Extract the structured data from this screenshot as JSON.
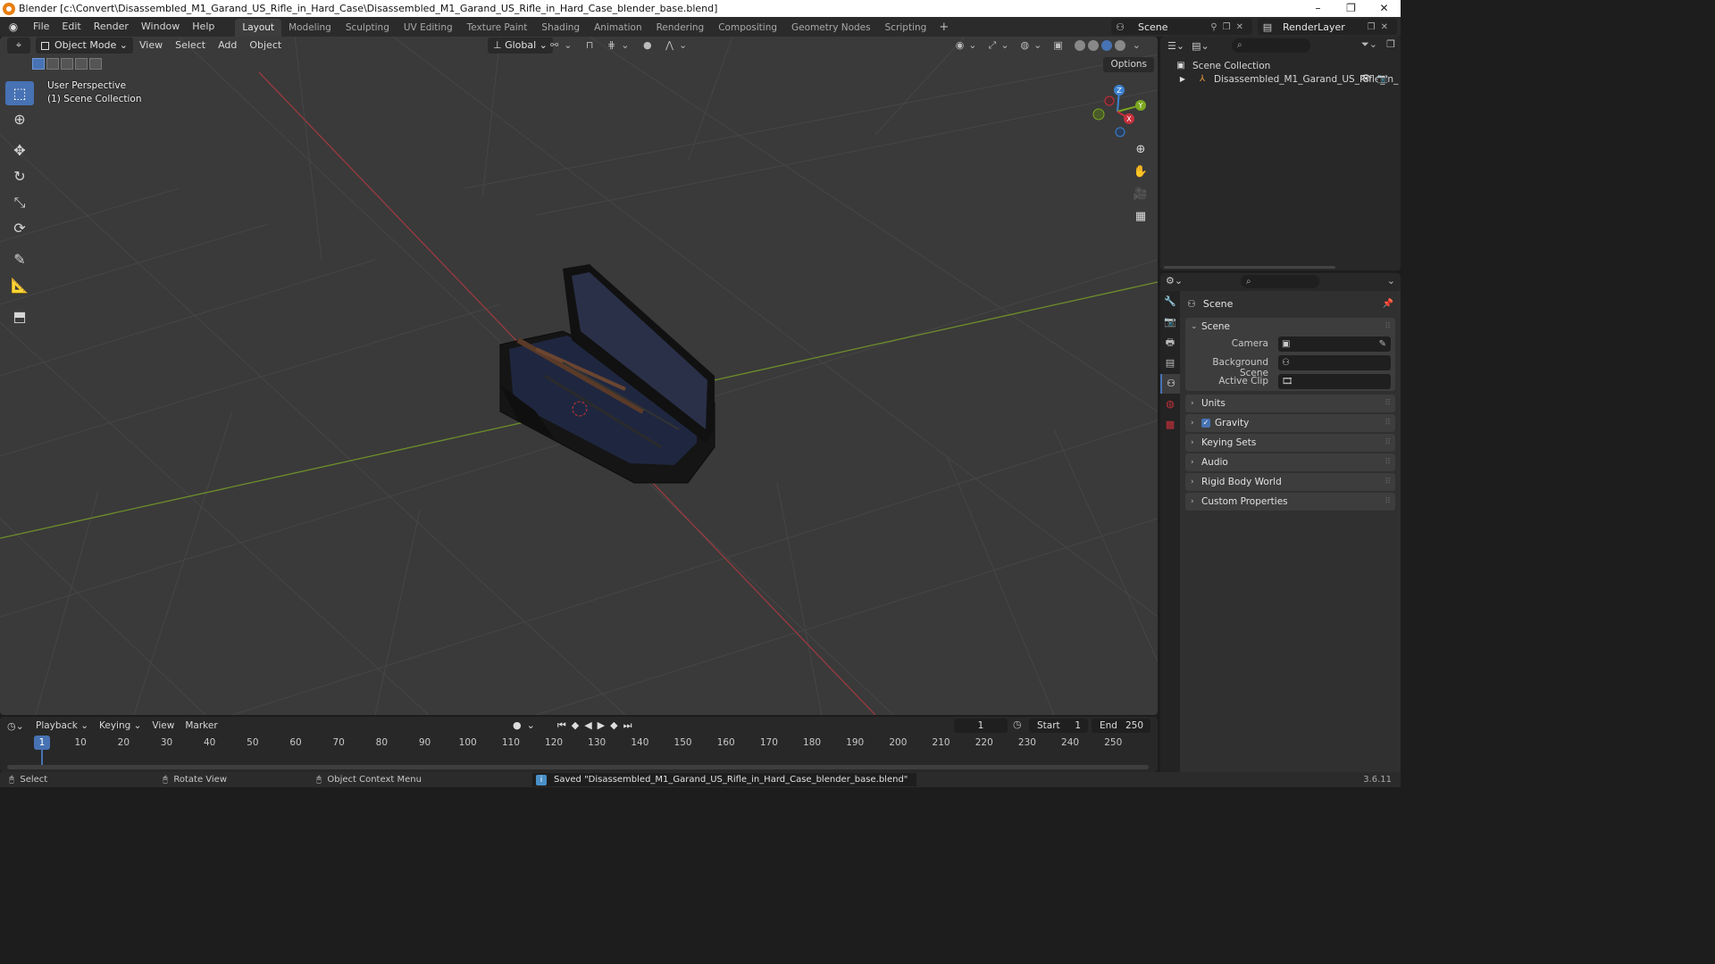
{
  "window": {
    "title": "Blender [c:\\Convert\\Disassembled_M1_Garand_US_Rifle_in_Hard_Case\\Disassembled_M1_Garand_US_Rifle_in_Hard_Case_blender_base.blend]",
    "minimize": "–",
    "maximize": "❐",
    "close": "✕"
  },
  "menu": {
    "items": [
      "File",
      "Edit",
      "Render",
      "Window",
      "Help"
    ]
  },
  "workspaces": {
    "tabs": [
      "Layout",
      "Modeling",
      "Sculpting",
      "UV Editing",
      "Texture Paint",
      "Shading",
      "Animation",
      "Rendering",
      "Compositing",
      "Geometry Nodes",
      "Scripting"
    ],
    "active": "Layout",
    "add": "+"
  },
  "scene_selector": {
    "name": "Scene"
  },
  "layer_selector": {
    "name": "RenderLayer"
  },
  "viewport": {
    "mode": "Object Mode",
    "menus": [
      "View",
      "Select",
      "Add",
      "Object"
    ],
    "transform_orientation": "Global",
    "options": "Options",
    "info_line1": "User Perspective",
    "info_line2": "(1) Scene Collection",
    "axis_colors": {
      "x": "#c8303c",
      "y": "#7ca81e",
      "z": "#3d83d1"
    }
  },
  "outliner": {
    "search_placeholder": "⌕",
    "root": "Scene Collection",
    "object": "Disassembled_M1_Garand_US_Rifle_in_"
  },
  "properties": {
    "search_placeholder": "⌕",
    "context": "Scene",
    "panel_scene": "Scene",
    "camera_label": "Camera",
    "background_scene_label": "Background Scene",
    "active_clip_label": "Active Clip",
    "collapsed_panels": [
      "Units",
      "Gravity",
      "Keying Sets",
      "Audio",
      "Rigid Body World",
      "Custom Properties"
    ],
    "gravity_checked": true
  },
  "timeline": {
    "menus": [
      "Playback",
      "Keying",
      "View",
      "Marker"
    ],
    "current_frame": "1",
    "start_label": "Start",
    "start_value": "1",
    "end_label": "End",
    "end_value": "250",
    "ruler": [
      "10",
      "20",
      "30",
      "40",
      "50",
      "60",
      "70",
      "80",
      "90",
      "100",
      "110",
      "120",
      "130",
      "140",
      "150",
      "160",
      "170",
      "180",
      "190",
      "200",
      "210",
      "220",
      "230",
      "240",
      "250"
    ],
    "cursor_label": "1"
  },
  "statusbar": {
    "select": "Select",
    "rotate": "Rotate View",
    "context_menu": "Object Context Menu",
    "message": "Saved \"Disassembled_M1_Garand_US_Rifle_in_Hard_Case_blender_base.blend\"",
    "version": "3.6.11"
  }
}
